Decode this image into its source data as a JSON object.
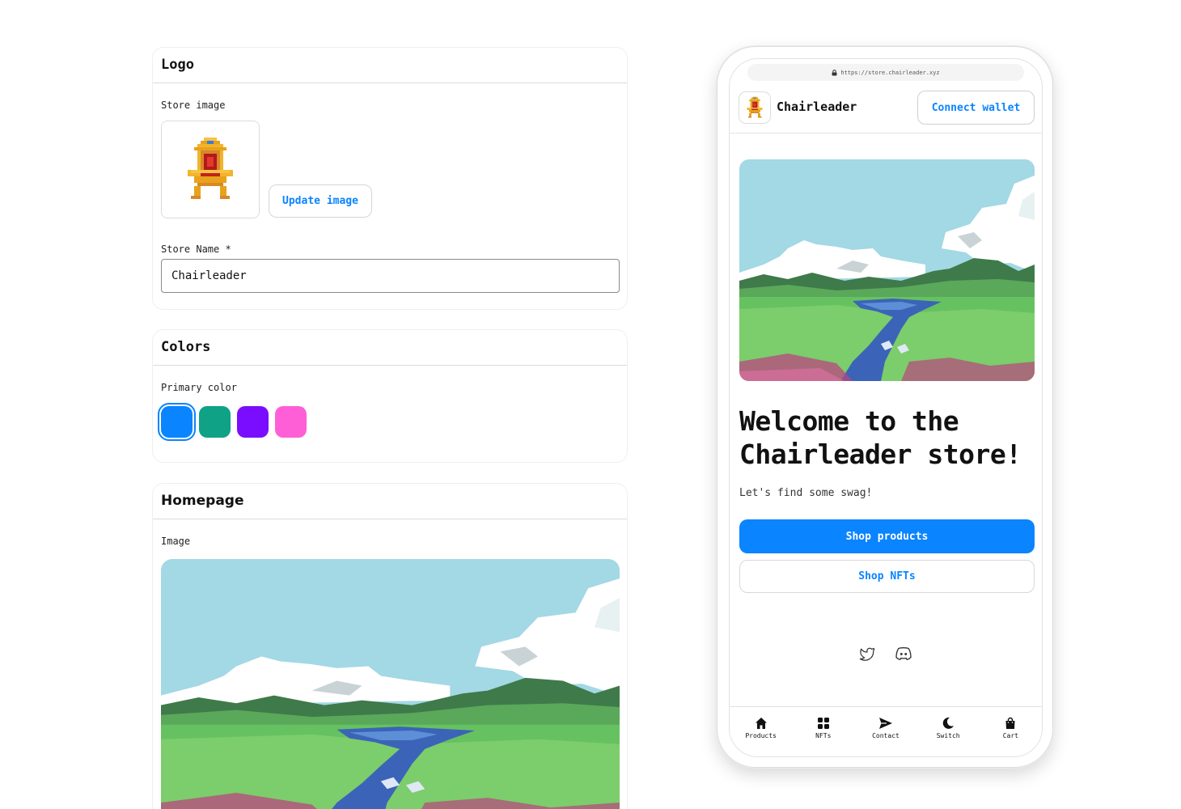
{
  "settings": {
    "logo_section": {
      "title": "Logo",
      "store_image_label": "Store image",
      "update_image_label": "Update image",
      "store_name_label": "Store Name *",
      "store_name_value": "Chairleader"
    },
    "colors_section": {
      "title": "Colors",
      "primary_color_label": "Primary color",
      "swatches": [
        "#0a84ff",
        "#0fa286",
        "#7a0dff",
        "#ff5fd6"
      ],
      "selected_swatch": "#0a84ff"
    },
    "homepage_section": {
      "title": "Homepage",
      "image_label": "Image"
    }
  },
  "preview": {
    "url": "https://store.chairleader.xyz",
    "store_name": "Chairleader",
    "connect_wallet_label": "Connect wallet",
    "hero_title": "Welcome to the Chairleader store!",
    "hero_subtitle": "Let's find some swag!",
    "shop_products_label": "Shop products",
    "shop_nfts_label": "Shop NFTs",
    "social_icons": [
      "twitter-icon",
      "discord-icon"
    ],
    "tabs": [
      {
        "label": "Products",
        "icon": "home-icon"
      },
      {
        "label": "NFTs",
        "icon": "grid-icon"
      },
      {
        "label": "Contact",
        "icon": "send-icon"
      },
      {
        "label": "Switch",
        "icon": "moon-icon"
      },
      {
        "label": "Cart",
        "icon": "bag-icon"
      }
    ]
  }
}
